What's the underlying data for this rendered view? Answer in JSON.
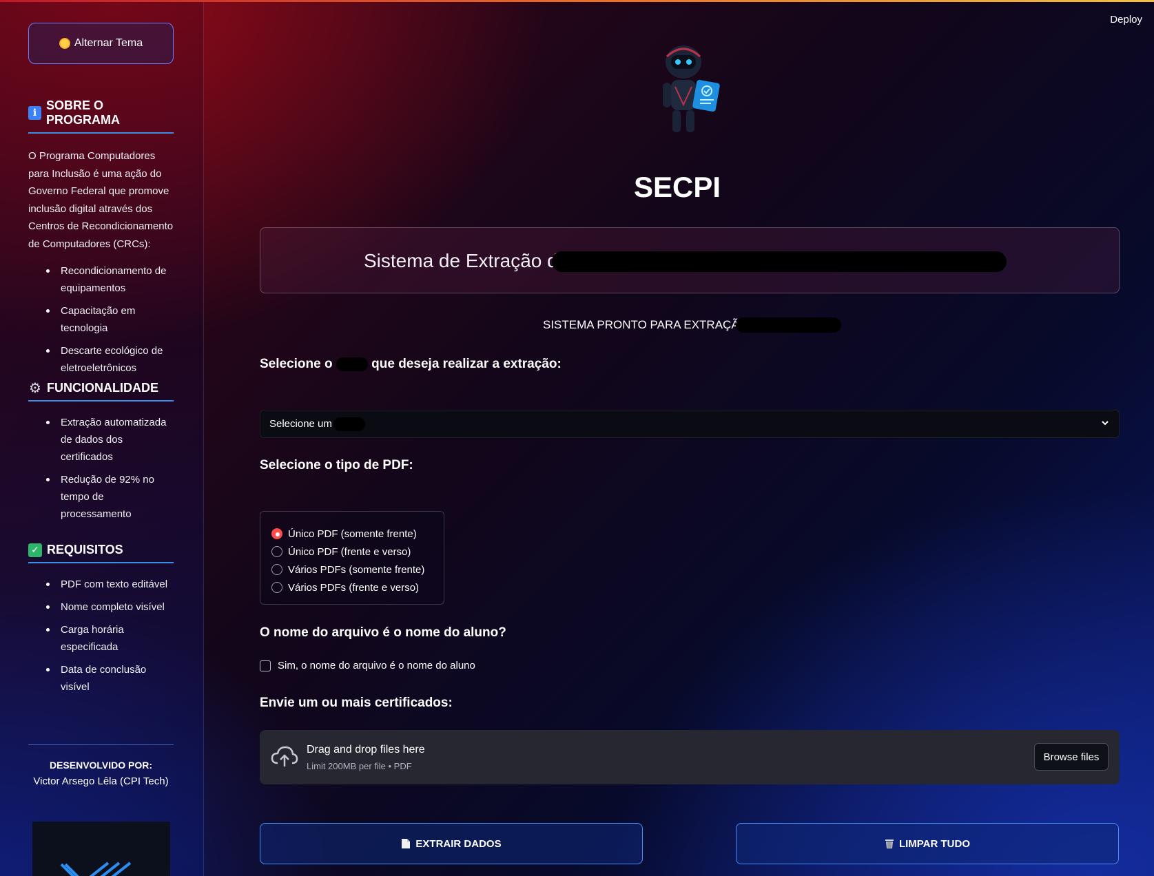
{
  "app": {
    "title": "SECPI",
    "deploy_label": "Deploy"
  },
  "sidebar": {
    "theme_button": {
      "label": "Alternar Tema",
      "icon": "sun-icon"
    },
    "about": {
      "title": "SOBRE O PROGRAMA",
      "icon": "info-icon",
      "text": "O Programa Computadores para Inclusão é uma ação do Governo Federal que promove inclusão digital através dos Centros de Recondicionamento de Computadores (CRCs):",
      "items": [
        "Recondicionamento de equipamentos",
        "Capacitação em tecnologia",
        "Descarte ecológico de eletroeletrônicos"
      ]
    },
    "features": {
      "title": "FUNCIONALIDADE",
      "icon": "gear-icon",
      "items": [
        "Extração automatizada de dados dos certificados",
        "Redução de 92% no tempo de processamento"
      ]
    },
    "requirements": {
      "title": "REQUISITOS",
      "icon": "check-icon",
      "items": [
        "PDF com texto editável",
        "Nome completo visível",
        "Carga horária especificada",
        "Data de conclusão visível"
      ]
    },
    "developer": {
      "label": "DESENVOLVIDO POR:",
      "name": "Victor Arsego Lêla (CPI Tech)"
    }
  },
  "main": {
    "system_title": "Sistema de Extração de",
    "status": "SISTEMA PRONTO PARA EXTRAÇÃO",
    "select_label_prefix": "Selecione o",
    "select_label_suffix": "que deseja realizar a extração:",
    "select_value": "Selecione um",
    "pdf_type_label": "Selecione o tipo de PDF:",
    "pdf_options": [
      {
        "label": "Único PDF (somente frente)",
        "selected": true
      },
      {
        "label": "Único PDF (frente e verso)",
        "selected": false
      },
      {
        "label": "Vários PDFs (somente frente)",
        "selected": false
      },
      {
        "label": "Vários PDFs (frente e verso)",
        "selected": false
      }
    ],
    "filename_question": "O nome do arquivo é o nome do aluno?",
    "filename_checkbox": "Sim, o nome do arquivo é o nome do aluno",
    "upload_label": "Envie um ou mais certificados:",
    "uploader": {
      "main_text": "Drag and drop files here",
      "sub_text": "Limit 200MB per file • PDF",
      "browse_label": "Browse files"
    },
    "extract_button": "EXTRAIR DADOS",
    "clear_button": "LIMPAR TUDO"
  },
  "colors": {
    "accent_red": "#ff4b4b",
    "border_blue": "#4b8df0",
    "divider_blue": "#3a8fe6"
  }
}
